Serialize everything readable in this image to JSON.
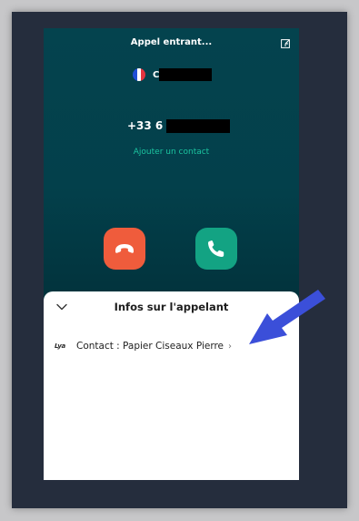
{
  "call": {
    "title": "Appel entrant...",
    "caller_name_visible": "C",
    "number_visible": "+33 6",
    "add_contact_label": "Ajouter un contact"
  },
  "flag": {
    "colors": [
      "#1f4fd6",
      "#ffffff",
      "#e5343f"
    ]
  },
  "buttons": {
    "decline_icon": "phone-hangup-icon",
    "accept_icon": "phone-icon"
  },
  "sheet": {
    "title": "Infos sur l'appelant",
    "logo_text": "Lya",
    "contact_label": "Contact : Papier Ciseaux Pierre"
  },
  "annotation": {
    "arrow_color": "#3b4fd9"
  }
}
